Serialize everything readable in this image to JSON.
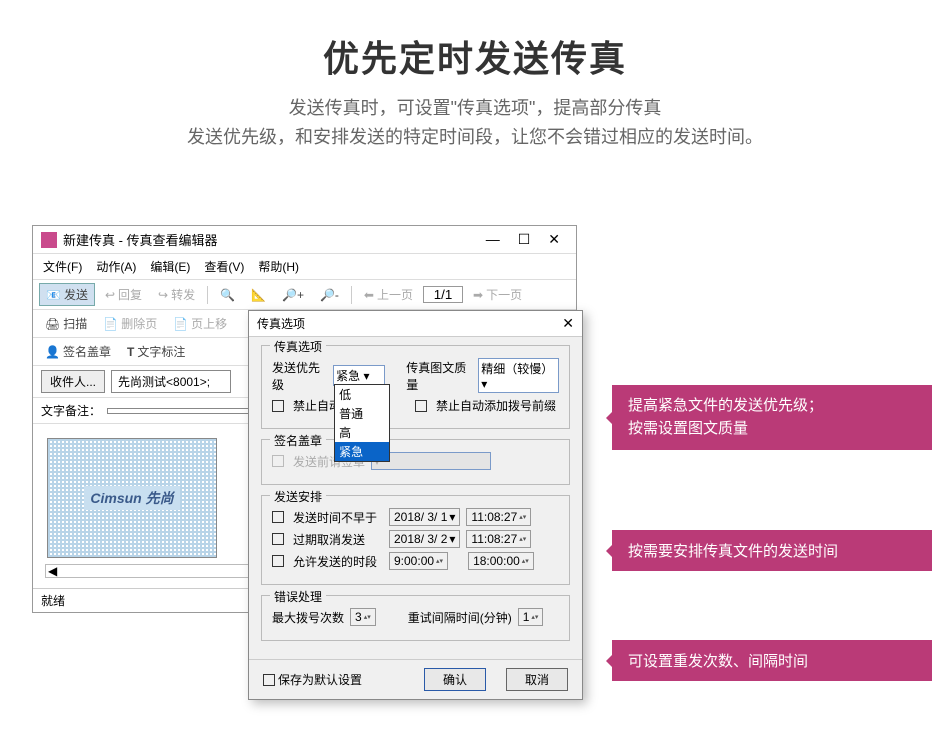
{
  "header": {
    "title": "优先定时发送传真",
    "line1": "发送传真时，可设置\"传真选项\"，提高部分传真",
    "line2": "发送优先级，和安排发送的特定时间段，让您不会错过相应的发送时间。"
  },
  "window": {
    "title": "新建传真 - 传真查看编辑器",
    "menus": {
      "file": "文件(F)",
      "action": "动作(A)",
      "edit": "编辑(E)",
      "view": "查看(V)",
      "help": "帮助(H)"
    },
    "toolbar1": {
      "send": "发送",
      "reply": "回复",
      "forward": "转发",
      "prev_page": "上一页",
      "page": "1/1",
      "next_page": "下一页"
    },
    "toolbar2": {
      "scan": "扫描",
      "delete_page": "删除页",
      "move_up": "页上移"
    },
    "toolbar3": {
      "sign_stamp": "签名盖章",
      "text_annot": "文字标注"
    },
    "recipient": {
      "btn": "收件人...",
      "value": "先尚测试<8001>;"
    },
    "note": {
      "label": "文字备注：",
      "value": ""
    },
    "preview_logo": "Cimsun 先尚",
    "status": "就绪"
  },
  "dialog": {
    "title": "传真选项",
    "groups": {
      "fax_opts": {
        "title": "传真选项",
        "priority_label": "发送优先级",
        "priority_value": "紧急",
        "priority_options": [
          "低",
          "普通",
          "高",
          "紧急"
        ],
        "quality_label": "传真图文质量",
        "quality_value": "精细（较慢）",
        "forbid_auto1": "禁止自动拨",
        "forbid_auto2": "禁止自动添加拨号前缀"
      },
      "sign": {
        "title": "签名盖章",
        "pre_sign": "发送前请签章"
      },
      "schedule": {
        "title": "发送安排",
        "not_before": "发送时间不早于",
        "date1": "2018/ 3/ 1",
        "time1": "11:08:27",
        "expire_cancel": "过期取消发送",
        "date2": "2018/ 3/ 2",
        "time2": "11:08:27",
        "allow_period": "允许发送的时段",
        "time3": "9:00:00",
        "time4": "18:00:00"
      },
      "error": {
        "title": "错误处理",
        "max_dial_label": "最大拨号次数",
        "max_dial": "3",
        "retry_label": "重试间隔时间(分钟)",
        "retry": "1"
      }
    },
    "save_default": "保存为默认设置",
    "ok": "确认",
    "cancel": "取消"
  },
  "callouts": {
    "c1a": "提高紧急文件的发送优先级；",
    "c1b": "按需设置图文质量",
    "c2": "按需要安排传真文件的发送时间",
    "c3": "可设置重发次数、间隔时间"
  }
}
